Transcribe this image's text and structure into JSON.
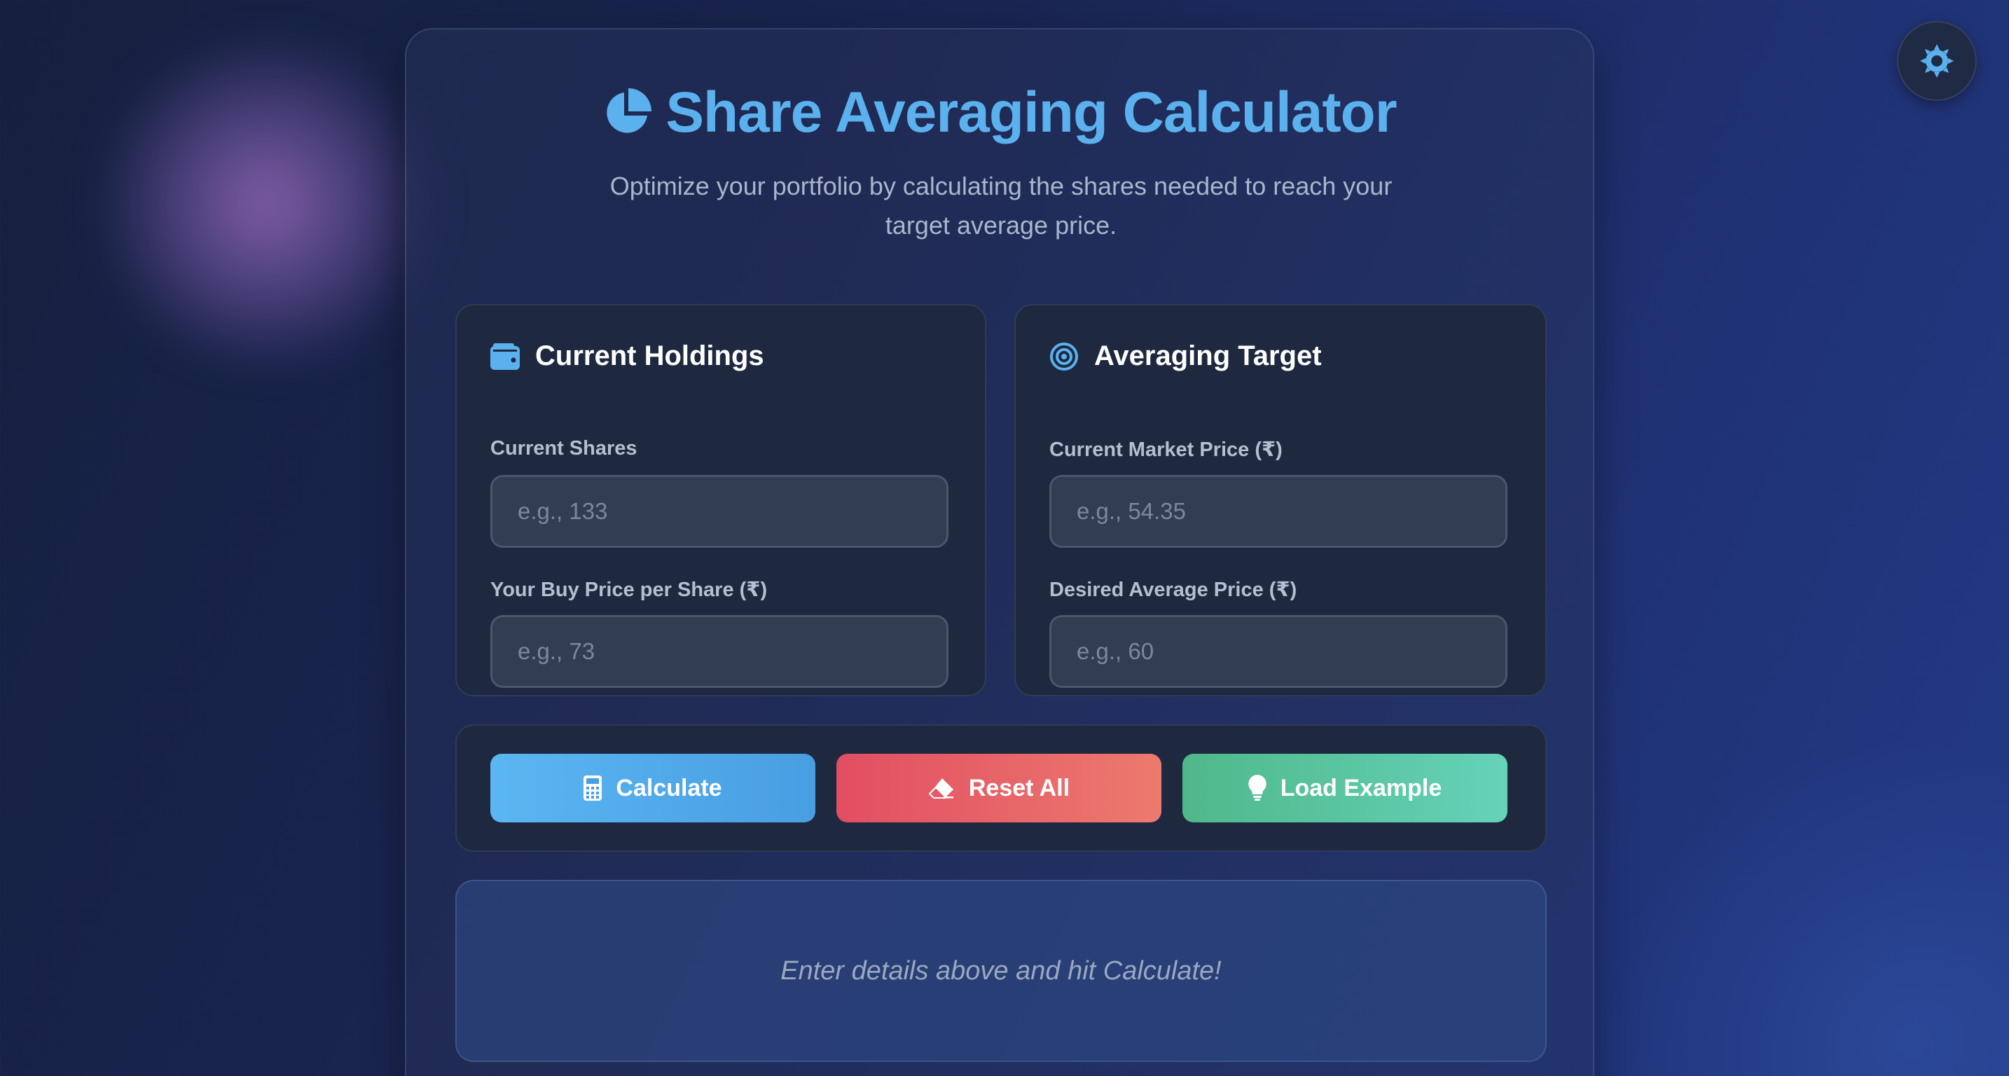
{
  "header": {
    "title": "Share Averaging Calculator",
    "subtitle": "Optimize your portfolio by calculating the shares needed to reach your target average price."
  },
  "theme_toggle": {
    "icon": "sun-icon"
  },
  "holdings": {
    "title": "Current Holdings",
    "icon": "wallet-icon",
    "fields": [
      {
        "label": "Current Shares",
        "placeholder": "e.g., 133",
        "value": ""
      },
      {
        "label": "Your Buy Price per Share (₹)",
        "placeholder": "e.g., 73",
        "value": ""
      }
    ]
  },
  "target": {
    "title": "Averaging Target",
    "icon": "target-icon",
    "fields": [
      {
        "label": "Current Market Price (₹)",
        "placeholder": "e.g., 54.35",
        "value": ""
      },
      {
        "label": "Desired Average Price (₹)",
        "placeholder": "e.g., 60",
        "value": ""
      }
    ]
  },
  "actions": {
    "calculate": {
      "label": "Calculate",
      "icon": "calculator-icon"
    },
    "reset": {
      "label": "Reset All",
      "icon": "eraser-icon"
    },
    "example": {
      "label": "Load Example",
      "icon": "lightbulb-icon"
    }
  },
  "result": {
    "message": "Enter details above and hit Calculate!"
  },
  "colors": {
    "accent": "#5bb0ee",
    "calculate": "#5bb6f2",
    "reset": "#e24e62",
    "example": "#4fb88a"
  }
}
